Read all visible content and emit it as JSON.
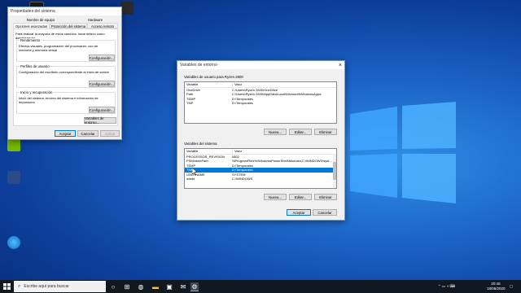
{
  "desktop_icons": [
    {
      "label": "",
      "color": "#1a1a1a"
    },
    {
      "label": "",
      "color": "#2a2a2a"
    },
    {
      "label": "",
      "color": "#76b900"
    },
    {
      "label": "",
      "color": "#2a4a8a"
    },
    {
      "label": "",
      "color": "#22416a"
    }
  ],
  "sysprops": {
    "title": "Propiedades del sistema",
    "tabs_top": [
      "Nombre de equipo",
      "Hardware"
    ],
    "tabs_bottom": [
      "Opciones avanzadas",
      "Protección del sistema",
      "Acceso remoto"
    ],
    "admin_note": "Para realizar la mayoría de estos cambios, inicie sesión como administrador.",
    "perf": {
      "title": "Rendimiento",
      "text": "Efectos visuales, programación del procesador, uso de memoria y memoria virtual",
      "button": "Configuración..."
    },
    "profiles": {
      "title": "Perfiles de usuario",
      "text": "Configuración del escritorio correspondiente al inicio de sesión",
      "button": "Configuración..."
    },
    "startup": {
      "title": "Inicio y recuperación",
      "text": "Inicio del sistema, errores del sistema e información de depuración",
      "button": "Configuración..."
    },
    "env_button": "Variables de entorno...",
    "ok": "Aceptar",
    "cancel": "Cancelar",
    "apply": "Aplicar"
  },
  "envvars": {
    "title": "Variables de entorno",
    "user_section": "Variables de usuario para Ryzen 2600",
    "col_var": "Variable",
    "col_val": "Valor",
    "user_rows": [
      {
        "name": "OneDrive",
        "value": "C:\\Users\\Ryzen 2600\\OneDrive"
      },
      {
        "name": "Path",
        "value": "C:\\Users\\Ryzen 2600\\AppData\\Local\\Microsoft\\WindowsApps;"
      },
      {
        "name": "TEMP",
        "value": "D:\\Temporales"
      },
      {
        "name": "TMP",
        "value": "D:\\Temporales"
      }
    ],
    "system_section": "Variables del sistema",
    "system_rows": [
      {
        "name": "PROCESSOR_REVISION",
        "value": "0802"
      },
      {
        "name": "PSModulePath",
        "value": "%ProgramFiles%\\WindowsPowerShell\\Modules;C:\\WINDOWS\\syst..."
      },
      {
        "name": "TEMP",
        "value": "D:\\Temporales"
      },
      {
        "name": "TMP",
        "value": "D:\\Temporales"
      },
      {
        "name": "USERNAME",
        "value": "SYSTEM"
      },
      {
        "name": "windir",
        "value": "C:\\WINDOWS"
      }
    ],
    "selected_system_index": 3,
    "new": "Nueva...",
    "edit": "Editar...",
    "delete": "Eliminar",
    "ok": "Aceptar",
    "cancel": "Cancelar"
  },
  "taskbar": {
    "search_placeholder": "Escribe aquí para buscar",
    "time": "20:45",
    "date": "18/06/2020"
  },
  "colors": {
    "accent": "#0078d7"
  }
}
